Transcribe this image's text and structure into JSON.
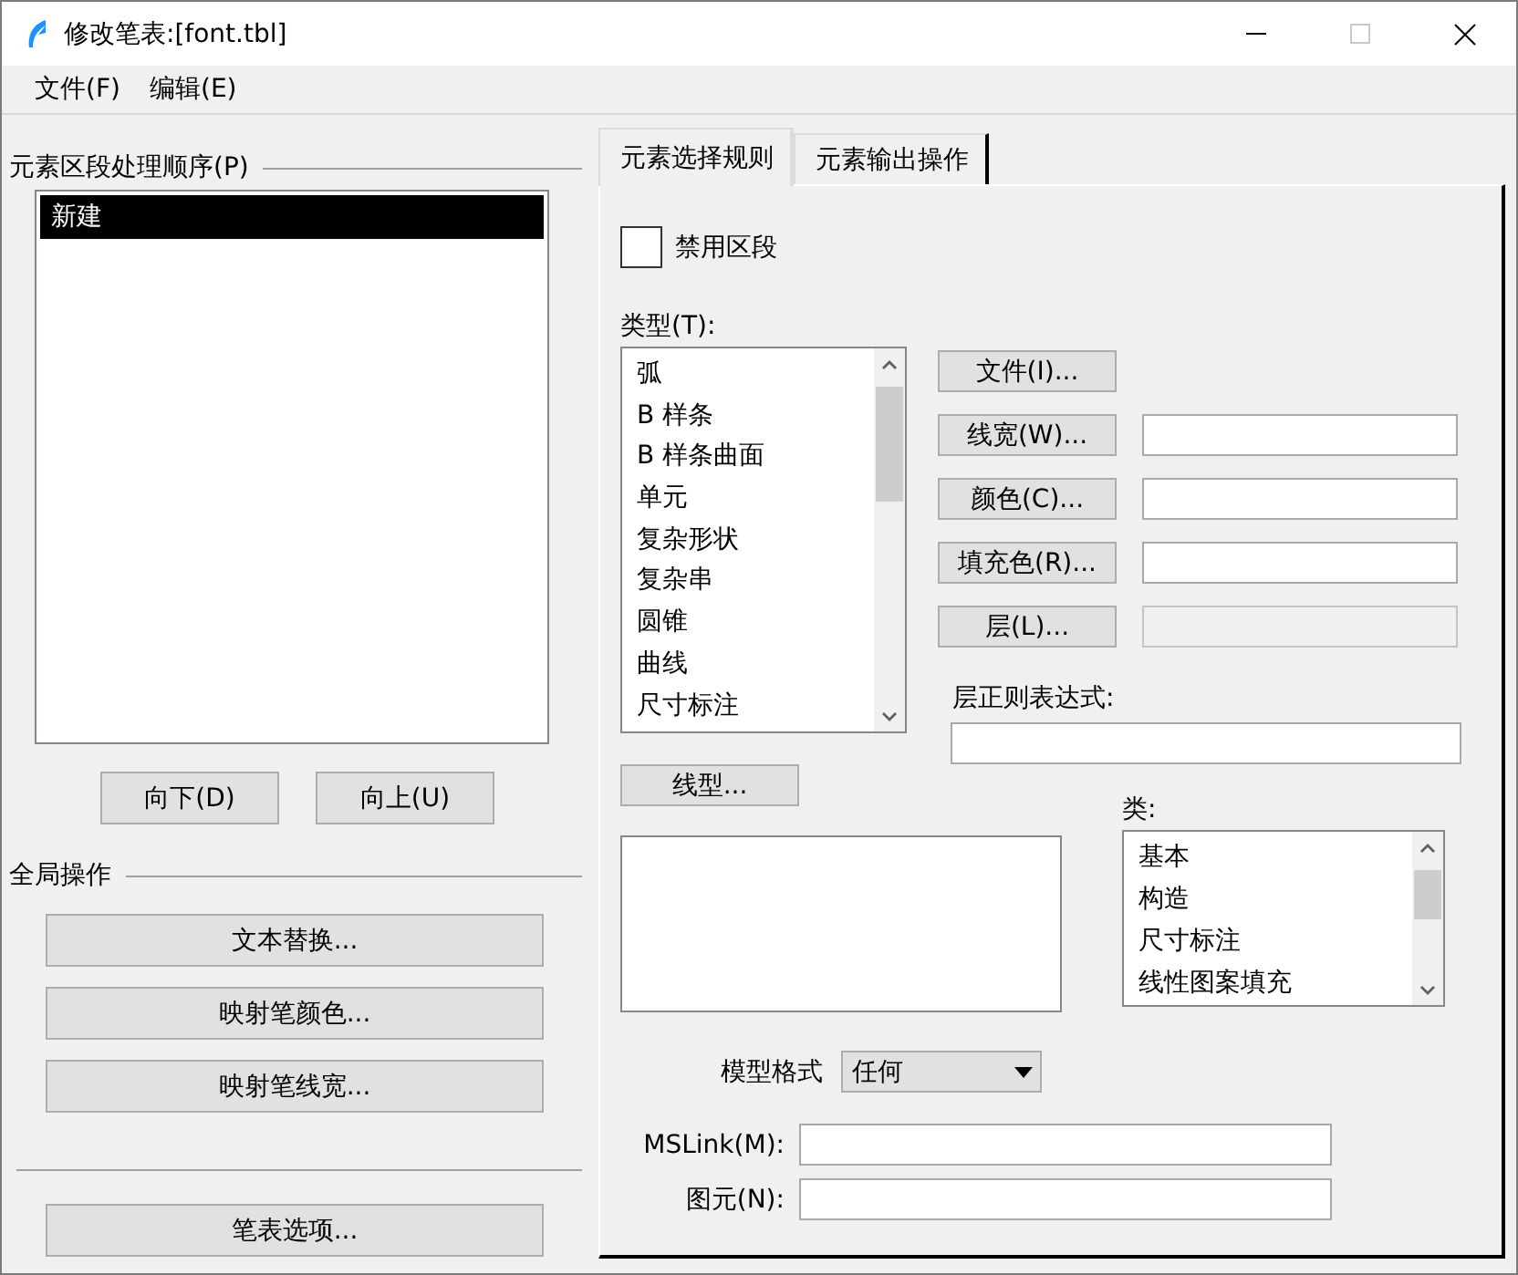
{
  "window": {
    "title": "修改笔表:[font.tbl]",
    "maximize_disabled": true
  },
  "menu": [
    "文件(F)",
    "编辑(E)"
  ],
  "sections": {
    "title": "元素区段处理顺序(P)",
    "items": [
      {
        "label": "新建",
        "selected": true
      }
    ],
    "buttons": [
      "向下(D)",
      "向上(U)"
    ]
  },
  "global_ops": {
    "title": "全局操作",
    "buttons": [
      "文本替换...",
      "映射笔颜色...",
      "映射笔线宽..."
    ]
  },
  "options_button": "笔表选项...",
  "tabs": [
    {
      "label": "元素选择规则",
      "selected": true
    },
    {
      "label": "元素输出操作",
      "selected": false
    }
  ],
  "disable_section": {
    "label": "禁用区段",
    "checked": false
  },
  "type_list": {
    "label": "类型(T):",
    "items": [
      {
        "label": "弧",
        "selected": false
      },
      {
        "label": "B 样条",
        "selected": false
      },
      {
        "label": "B 样条曲面",
        "selected": false
      },
      {
        "label": "单元",
        "selected": false
      },
      {
        "label": "复杂形状",
        "selected": false
      },
      {
        "label": "复杂串",
        "selected": false
      },
      {
        "label": "圆锥",
        "selected": false
      },
      {
        "label": "曲线",
        "selected": false
      },
      {
        "label": "尺寸标注",
        "selected": false
      }
    ]
  },
  "attribute_rows": [
    {
      "button": "文件(I)..."
    },
    {
      "button": "线宽(W)...",
      "field": {
        "disabled": false
      }
    },
    {
      "button": "颜色(C)...",
      "field": {
        "disabled": false
      }
    },
    {
      "button": "填充色(R)...",
      "field": {
        "disabled": false
      }
    },
    {
      "button": "层(L)...",
      "field": {
        "disabled": true
      }
    }
  ],
  "layer_regex": {
    "label": "层正则表达式:"
  },
  "linestyle_button": "线型...",
  "class_list": {
    "label": "类:",
    "items": [
      {
        "label": "基本",
        "selected": false
      },
      {
        "label": "构造",
        "selected": false
      },
      {
        "label": "尺寸标注",
        "selected": false
      },
      {
        "label": "线性图案填充",
        "selected": false
      }
    ]
  },
  "model_format": {
    "label": "模型格式",
    "value": "任何"
  },
  "mslink": {
    "label": "MSLink(M):"
  },
  "graphic": {
    "label": "图元(N):"
  }
}
